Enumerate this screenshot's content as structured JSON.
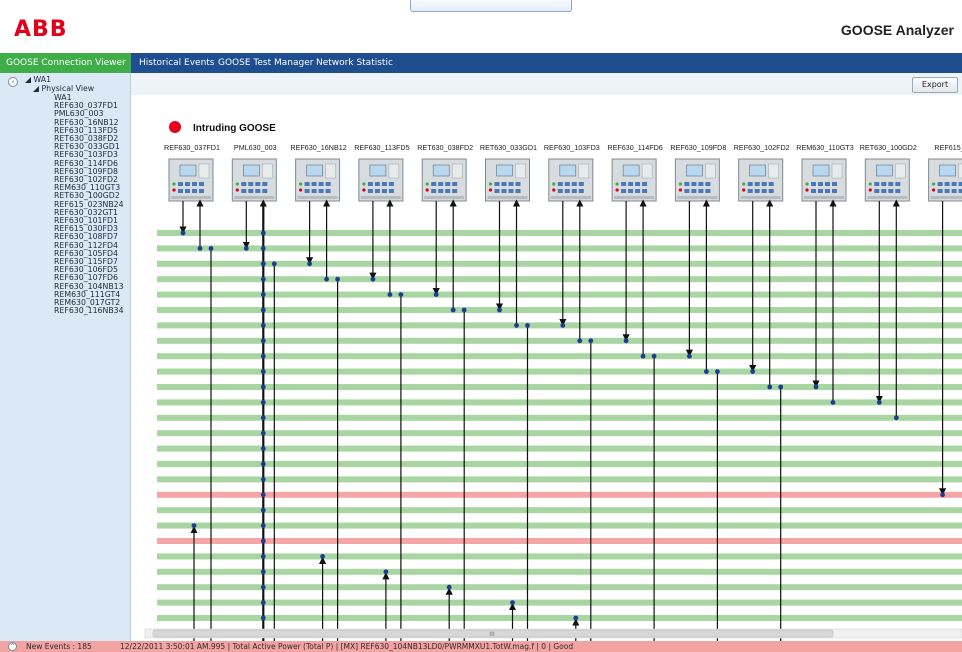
{
  "header": {
    "logo": "ABB",
    "app_title": "GOOSE Analyzer"
  },
  "nav": {
    "tabs": [
      {
        "label": "GOOSE Connection Viewer",
        "active": true
      },
      {
        "label": "Historical Events",
        "active": false
      },
      {
        "label": "GOOSE Test Manager",
        "active": false
      },
      {
        "label": "Network Statistic",
        "active": false
      }
    ]
  },
  "sidebar": {
    "toggle_glyph": "‹",
    "root": "◢ WA1",
    "physical_view": "◢ Physical View",
    "items": [
      "WA1",
      "REF630_037FD1",
      "PML630_003",
      "REF630_16NB12",
      "REF630_113FD5",
      "RET630_038FD2",
      "RET630_033GD1",
      "REF630_103FD3",
      "REF630_114FD6",
      "REF630_109FD8",
      "REF630_102FD2",
      "REM630_110GT3",
      "RET630_100GD2",
      "REF615_023NB24",
      "REF630_032GT1",
      "REF630_101FD1",
      "REF615_030FD3",
      "REF630_108FD7",
      "REF630_112FD4",
      "REF630_105FD4",
      "REF630_115FD7",
      "REF630_106FD5",
      "REF630_107FD6",
      "REF630_104NB13",
      "REM630_111GT4",
      "REM630_017GT2",
      "REF630_116NB34"
    ]
  },
  "toolbar": {
    "export_label": "Export"
  },
  "diagram": {
    "legend_label": "Intruding GOOSE",
    "devices": [
      "REF630_037FD1",
      "PML630_003",
      "REF630_16NB12",
      "REF630_113FD5",
      "RET630_038FD2",
      "RET630_033GD1",
      "REF630_103FD3",
      "REF630_114FD6",
      "REF630_109FD8",
      "REF630_102FD2",
      "REM630_110GT3",
      "RET630_100GD2",
      "REF615_0"
    ],
    "scrollbar_grip": "III",
    "colors": {
      "normal_row": "#a8d5a2",
      "intruding_row": "#f5a5a5",
      "intruding_marker": "#e8001c",
      "line": "#111111",
      "dot": "#1f3c8f"
    }
  },
  "statusbar": {
    "toggle_glyph": "^",
    "new_events": "New Events : 185",
    "message": "12/22/2011 3:50:01 AM.995 | Total Active Power (Total P) | [MX] REF630_104NB13LD0/PWRMMXU1.TotW.mag.f | 0 | Good"
  }
}
